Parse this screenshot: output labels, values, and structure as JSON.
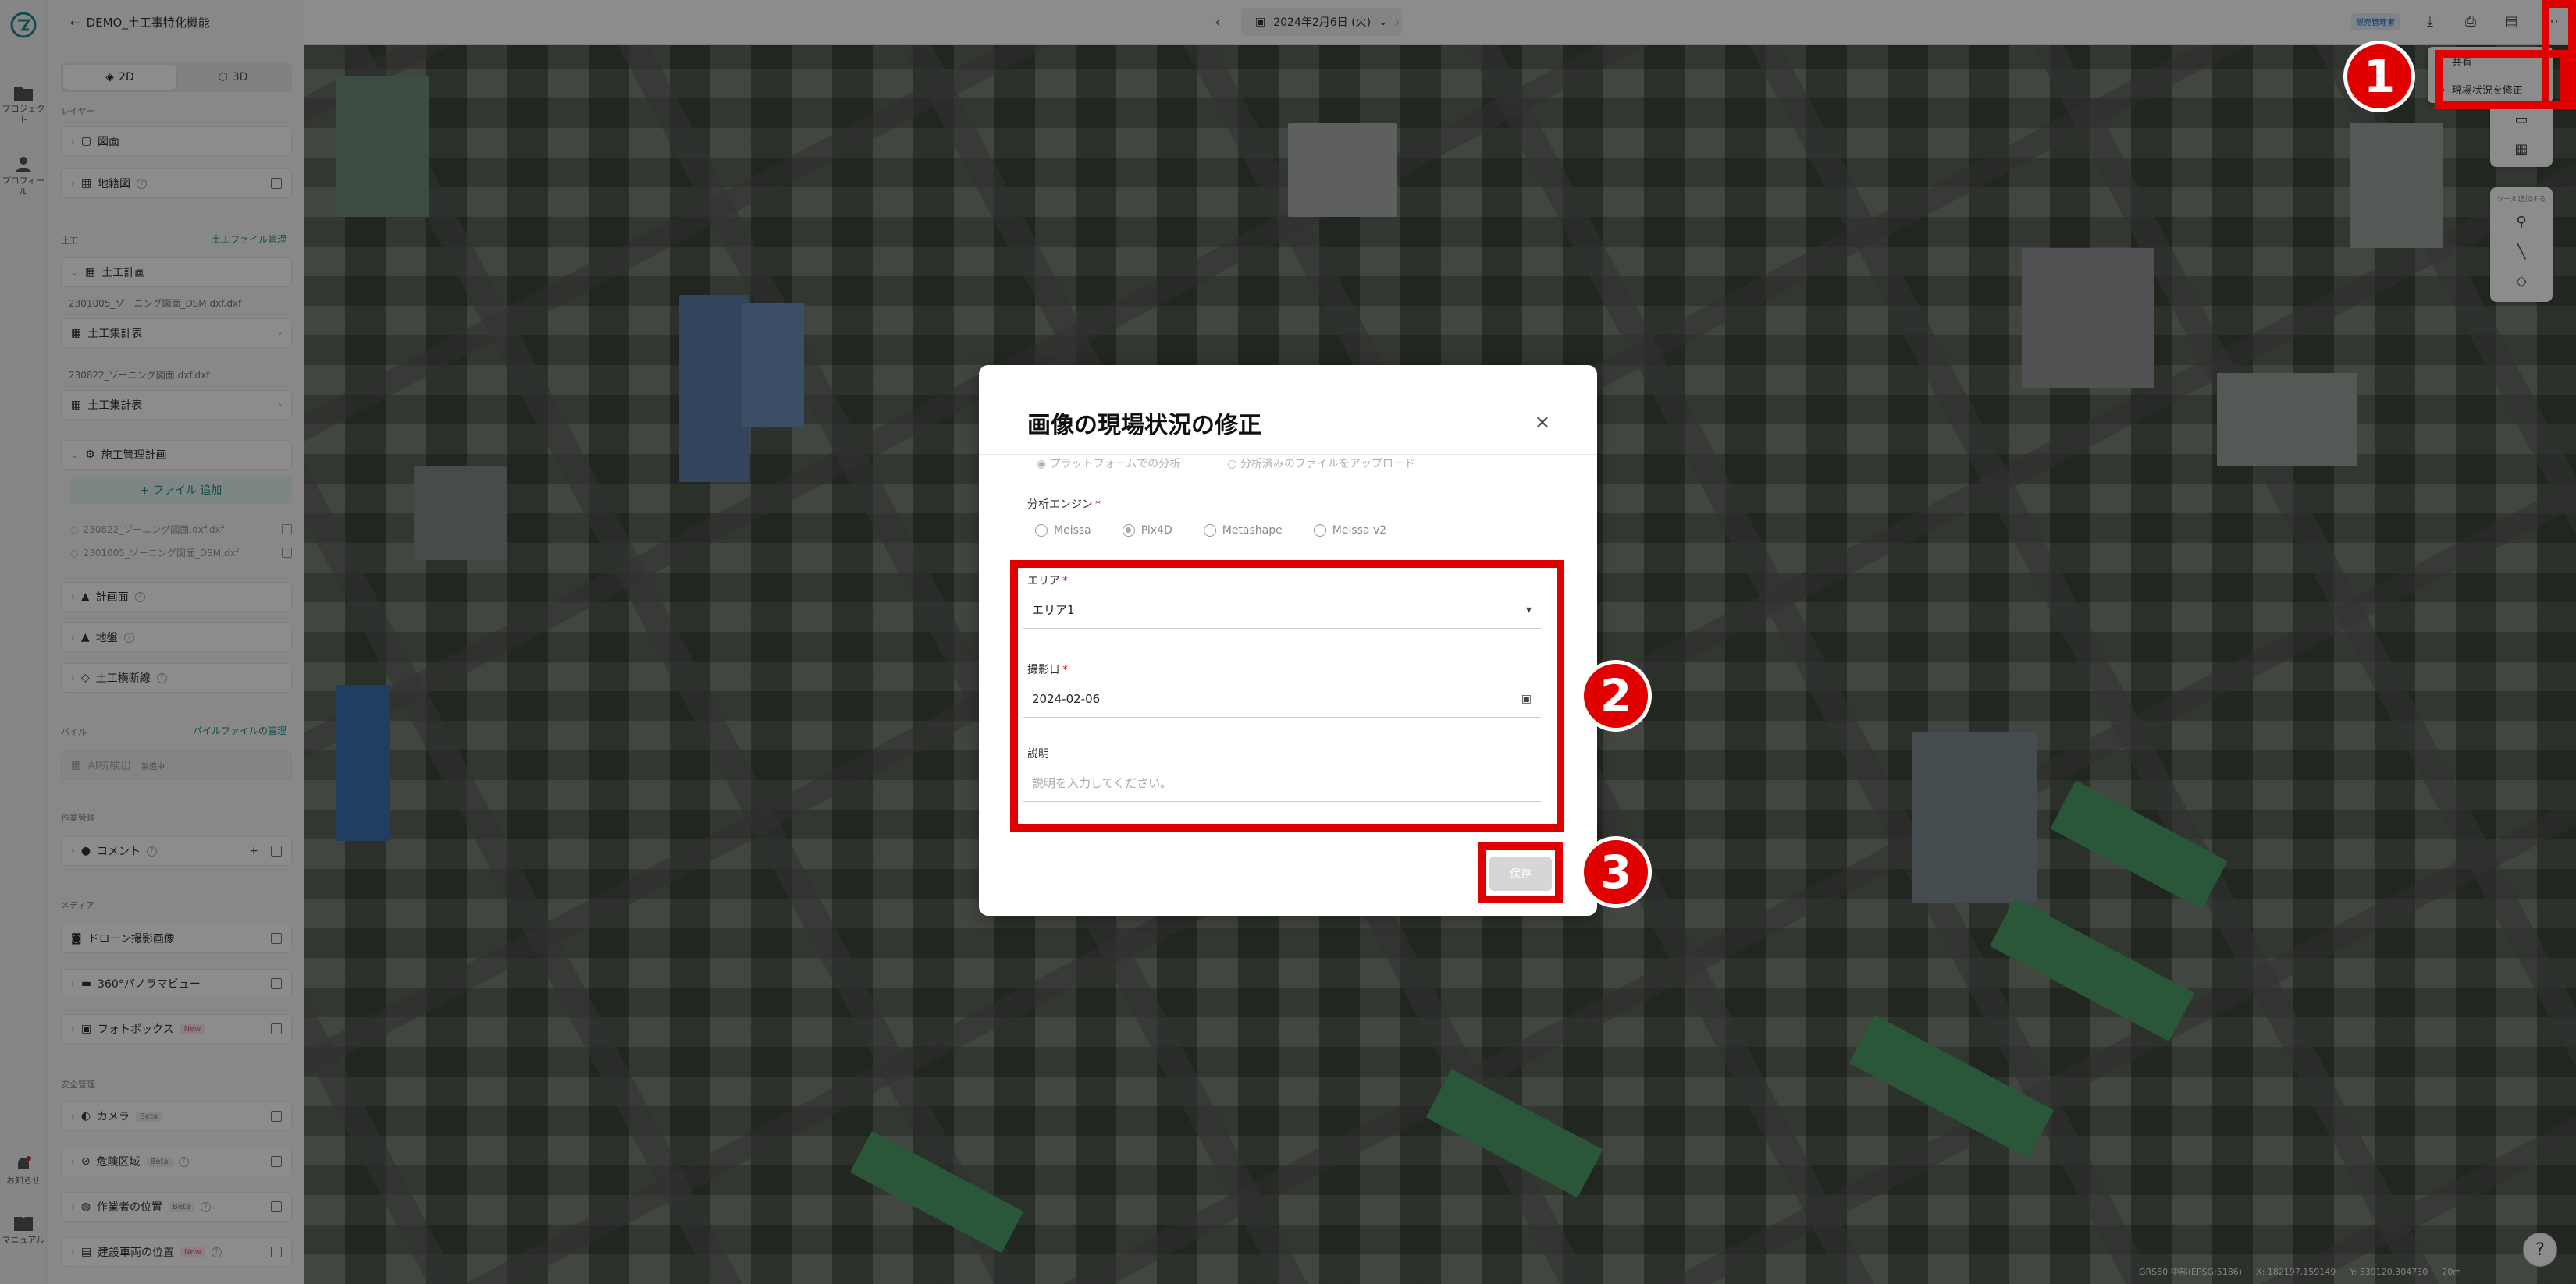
{
  "header": {
    "project_title": "DEMO_土工事特化機能",
    "date": "2024年2月6日 (火)",
    "badge": "販売管理者"
  },
  "rail": {
    "items": [
      {
        "label": "プロジェクト"
      },
      {
        "label": "プロフィール"
      },
      {
        "label": "お知らせ"
      },
      {
        "label": "マニュアル"
      }
    ]
  },
  "sidebar": {
    "mode_2d": "2D",
    "mode_3d": "3D",
    "layer_label": "レイヤー",
    "drawing": "図面",
    "topo": "地籍図",
    "earth_label": "土工",
    "earth_link": "土工ファイル管理",
    "earth_plan_group": "土工計画",
    "file1": "2301005_ゾーニング図面_DSM.dxf.dxf",
    "file1_item": "土工集計表",
    "file2": "230822_ゾーニング図面.dxf.dxf",
    "file2_item": "土工集計表",
    "construction_group": "施工管理計画",
    "add_file": "+ ファイル 追加",
    "cfile1": "230822_ゾーニング図面.dxf.dxf",
    "cfile2": "2301005_ゾーニング図面_DSM.dxf",
    "plan_area": "計画面",
    "ground": "地盤",
    "earth_section": "土工横断線",
    "pile_label": "パイル",
    "pile_link": "パイルファイルの管理",
    "pile_item": "AI杭検出",
    "pile_tag": "製造中",
    "work_label": "作業管理",
    "comment": "コメント",
    "media_label": "メディア",
    "drone": "ドローン撮影画像",
    "pano": "360°パノラマビュー",
    "photobox": "フォトボックス",
    "new_tag": "New",
    "safety_label": "安全管理",
    "camera": "カメラ",
    "beta_tag": "Beta",
    "danger": "危険区域",
    "worker": "作業者の位置",
    "vehicle": "建設車両の位置"
  },
  "menu": {
    "share": "共有",
    "edit_site_status": "現場状況を修正"
  },
  "tools": {
    "title": "ツール追加する"
  },
  "status_bar": {
    "crs": "GRS80 中部(EPSG:5186)",
    "x": "X: 182197.159149",
    "y": "Y: 539120.304730",
    "scale": "20m"
  },
  "modal": {
    "title": "画像の現場状況の修正",
    "faded_option_1": "プラットフォームでの分析",
    "faded_option_2": "分析済みのファイルをアップロード",
    "engine_label": "分析エンジン",
    "engines": [
      {
        "label": "Meissa",
        "selected": false
      },
      {
        "label": "Pix4D",
        "selected": true
      },
      {
        "label": "Metashape",
        "selected": false
      },
      {
        "label": "Meissa v2",
        "selected": false
      }
    ],
    "area_label": "エリア",
    "area_value": "エリア1",
    "date_label": "撮影日",
    "date_value": "2024-02-06",
    "desc_label": "説明",
    "desc_placeholder": "説明を入力してください。",
    "save": "保存"
  },
  "annotations": {
    "step1": "1",
    "step2": "2",
    "step3": "3",
    "color": "#e00000"
  }
}
